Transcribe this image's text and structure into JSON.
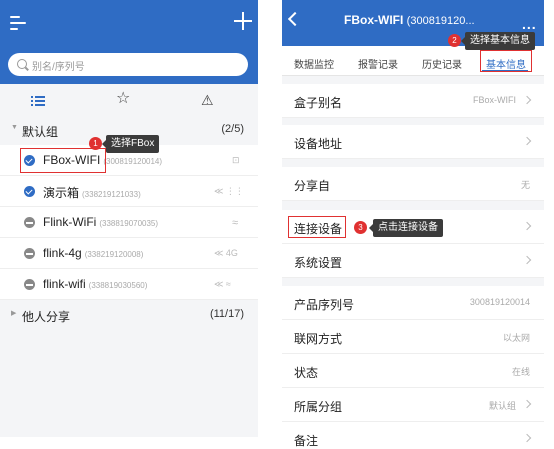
{
  "left": {
    "search_placeholder": "别名/序列号",
    "groups": [
      {
        "name": "默认组",
        "count": "(2/5)"
      },
      {
        "name": "他人分享",
        "count": "(11/17)"
      }
    ],
    "devices": [
      {
        "name": "FBox-WIFI",
        "sn": "(300819120014)",
        "status": "online",
        "icon": "⊡"
      },
      {
        "name": "演示箱",
        "sn": "(338219121033)",
        "status": "online",
        "icon": "≪ ⋮⋮"
      },
      {
        "name": "Flink-WiFi",
        "sn": "(338819070035)",
        "status": "offline",
        "icon": "≈"
      },
      {
        "name": "flink-4g",
        "sn": "(338219120008)",
        "status": "offline",
        "icon": "≪  4G"
      },
      {
        "name": "flink-wifi",
        "sn": "(338819030560)",
        "status": "offline",
        "icon": "≪  ≈"
      }
    ],
    "callout_1": {
      "num": "1",
      "text": "选择FBox"
    }
  },
  "right": {
    "title": "FBox-WIFI",
    "title_sn": "(300819120...",
    "more": "...",
    "tabs": [
      "数据监控",
      "报警记录",
      "历史记录",
      "基本信息"
    ],
    "callout_2": {
      "num": "2",
      "text": "选择基本信息"
    },
    "callout_3": {
      "num": "3",
      "text": "点击连接设备"
    },
    "rows": [
      {
        "label": "盒子别名",
        "value": "FBox-WIFI"
      },
      {
        "label": "设备地址",
        "value": ""
      },
      {
        "label": "分享自",
        "value": "无"
      },
      {
        "label": "连接设备",
        "value": ""
      },
      {
        "label": "系统设置",
        "value": ""
      },
      {
        "label": "产品序列号",
        "value": "300819120014"
      },
      {
        "label": "联网方式",
        "value": "以太网"
      },
      {
        "label": "状态",
        "value": "在线"
      },
      {
        "label": "所属分组",
        "value": "默认组"
      },
      {
        "label": "备注",
        "value": ""
      }
    ]
  },
  "colors": {
    "accent": "#2f6cc4",
    "highlight": "#e03131"
  }
}
